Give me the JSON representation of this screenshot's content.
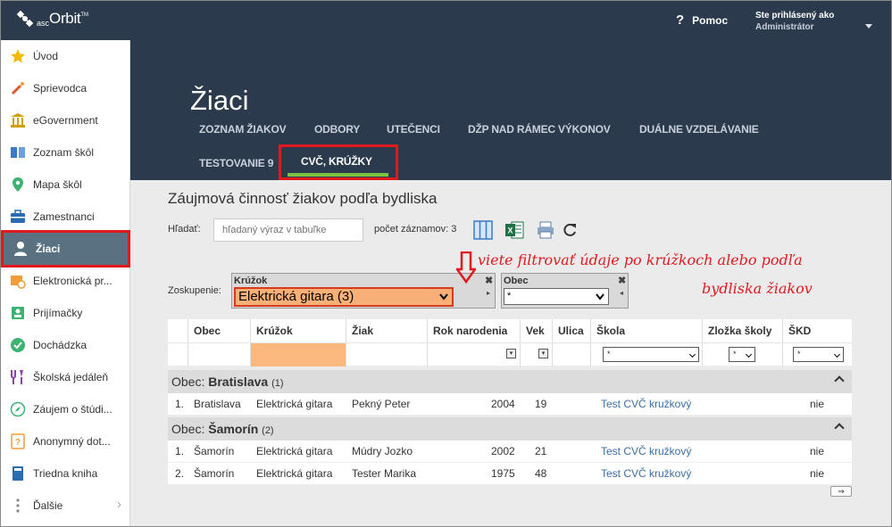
{
  "brand": {
    "prefix": "asc",
    "name": "Orbit",
    "tm": "TM"
  },
  "header": {
    "help_label": "Pomoc",
    "help_glyph": "?",
    "user_line1": "Ste prihlásený ako",
    "user_line2": "Administrátor"
  },
  "sidebar": {
    "items": [
      {
        "label": "Úvod",
        "icon": "star-icon"
      },
      {
        "label": "Sprievodca",
        "icon": "magic-wand-icon"
      },
      {
        "label": "eGovernment",
        "icon": "government-building-icon"
      },
      {
        "label": "Zoznam škôl",
        "icon": "school-list-icon"
      },
      {
        "label": "Mapa škôl",
        "icon": "map-pin-icon"
      },
      {
        "label": "Zamestnanci",
        "icon": "briefcase-icon"
      },
      {
        "label": "Žiaci",
        "icon": "student-icon"
      },
      {
        "label": "Elektronická pr...",
        "icon": "electronic-application-icon"
      },
      {
        "label": "Prijímačky",
        "icon": "admissions-icon"
      },
      {
        "label": "Dochádzka",
        "icon": "attendance-check-icon"
      },
      {
        "label": "Školská jedáleň",
        "icon": "cafeteria-icon"
      },
      {
        "label": "Záujem o štúdi...",
        "icon": "compass-icon"
      },
      {
        "label": "Anonymný dot...",
        "icon": "questionnaire-icon"
      },
      {
        "label": "Triedna kniha",
        "icon": "class-book-icon"
      },
      {
        "label": "Ďalšie",
        "icon": "more-dots-icon"
      }
    ],
    "active_index": 6,
    "colors": {
      "active_bg": "#5a7182",
      "highlight": "#e0191f"
    }
  },
  "page": {
    "title": "Žiaci",
    "tabs": [
      "ZOZNAM ŽIAKOV",
      "ODBORY",
      "UTEČENCI",
      "DŽP NAD RÁMEC VÝKONOV",
      "DUÁLNE VZDELÁVANIE",
      "TESTOVANIE 9",
      "CVČ, KRÚŽKY"
    ],
    "active_tab": 6,
    "subtitle": "Záujmová činnosť žiakov podľa bydliska"
  },
  "toolbar": {
    "search_label": "Hľadať:",
    "search_placeholder": "hľadaný výraz v tabuľke",
    "record_count": "počet záznamov: 3",
    "icons": [
      "columns-icon",
      "excel-icon",
      "print-icon",
      "refresh-icon"
    ]
  },
  "grouping": {
    "label": "Zoskupenie:",
    "box1_title": "Krúžok",
    "box1_value": "Elektrická gitara (3)",
    "box2_title": "Obec",
    "box2_value": "*",
    "close_glyph": "✖",
    "left_glyph": "◂",
    "right_glyph": "▸"
  },
  "annotation": {
    "line1": "viete filtrovať údaje po krúžkoch alebo podľa",
    "line2": "bydliska žiakov",
    "color": "#e0191f"
  },
  "table": {
    "columns": [
      "Obec",
      "Krúžok",
      "Žiak",
      "Rok narodenia",
      "Vek",
      "Ulica",
      "Škola",
      "Zložka školy",
      "ŠKD"
    ],
    "filters": {
      "skola": "*",
      "zlozka": "*",
      "skd": "*"
    },
    "groups": [
      {
        "prefix": "Obec:",
        "name": "Bratislava",
        "count": "(1)",
        "rows": [
          {
            "n": "1.",
            "obec": "Bratislava",
            "kruzok": "Elektrická gitara",
            "ziak": "Pekný Peter",
            "rok": "2004",
            "vek": "19",
            "ulica": "",
            "skola": "Test CVČ kružkový",
            "zlozka": "",
            "skd": "nie"
          }
        ]
      },
      {
        "prefix": "Obec:",
        "name": "Šamorín",
        "count": "(2)",
        "rows": [
          {
            "n": "1.",
            "obec": "Šamorín",
            "kruzok": "Elektrická gitara",
            "ziak": "Múdry Jozko",
            "rok": "2002",
            "vek": "21",
            "ulica": "",
            "skola": "Test CVČ kružkový",
            "zlozka": "",
            "skd": "nie"
          },
          {
            "n": "2.",
            "obec": "Šamorín",
            "kruzok": "Elektrická gitara",
            "ziak": "Tester Marika",
            "rok": "1975",
            "vek": "48",
            "ulica": "",
            "skola": "Test CVČ kružkový",
            "zlozka": "",
            "skd": "nie"
          }
        ]
      }
    ],
    "expand_glyph": "⇒"
  }
}
